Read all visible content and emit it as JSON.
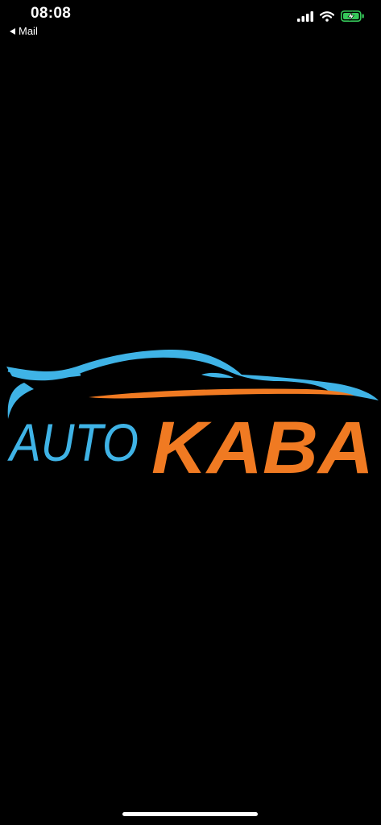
{
  "status_bar": {
    "time": "08:08",
    "back_label": "Mail",
    "icons": [
      "cellular-signal-icon",
      "wifi-icon",
      "battery-charging-icon"
    ]
  },
  "logo": {
    "word_left": "AUTO",
    "word_right": "KABA",
    "color_left": "#3fb3e6",
    "color_right": "#f07a22"
  },
  "colors": {
    "background": "#000000",
    "status_text": "#ffffff",
    "battery_green": "#35c759"
  }
}
